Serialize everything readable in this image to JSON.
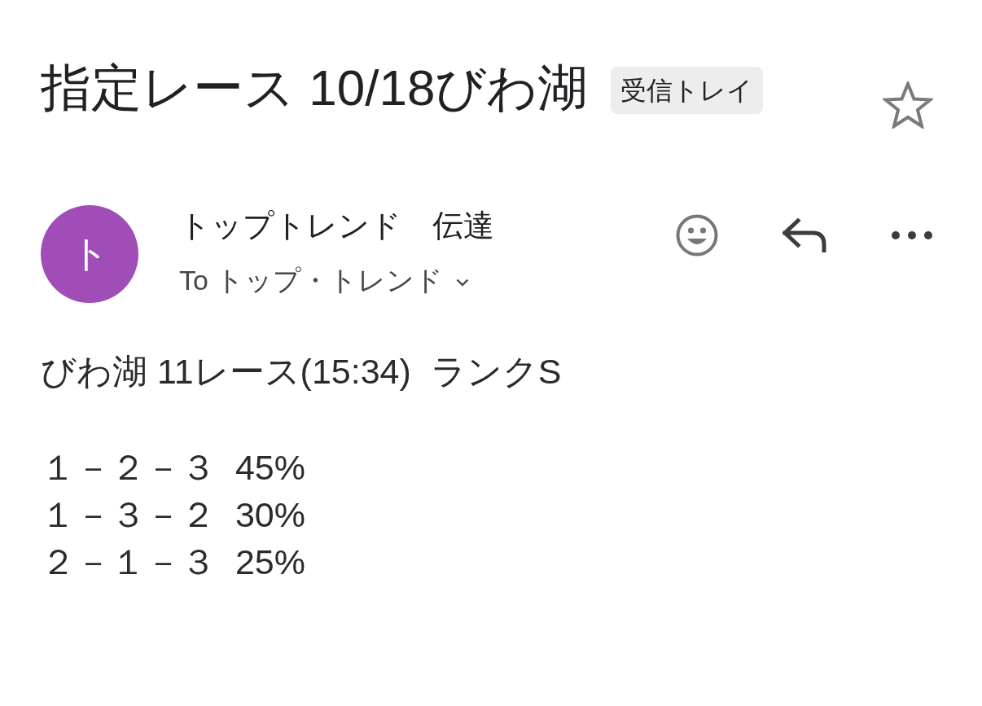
{
  "subject": {
    "title": "指定レース 10/18びわ湖",
    "label": "受信トレイ",
    "starred": false
  },
  "sender": {
    "avatar_letter": "ト",
    "name": "トップトレンド　伝達",
    "recipient": "To トップ・トレンド",
    "expanded": false
  },
  "body": {
    "heading": "びわ湖 11レース(15:34)  ランクS",
    "lines": [
      "１－２－３  45%",
      "１－３－２  30%",
      "２－１－３  25%"
    ]
  }
}
